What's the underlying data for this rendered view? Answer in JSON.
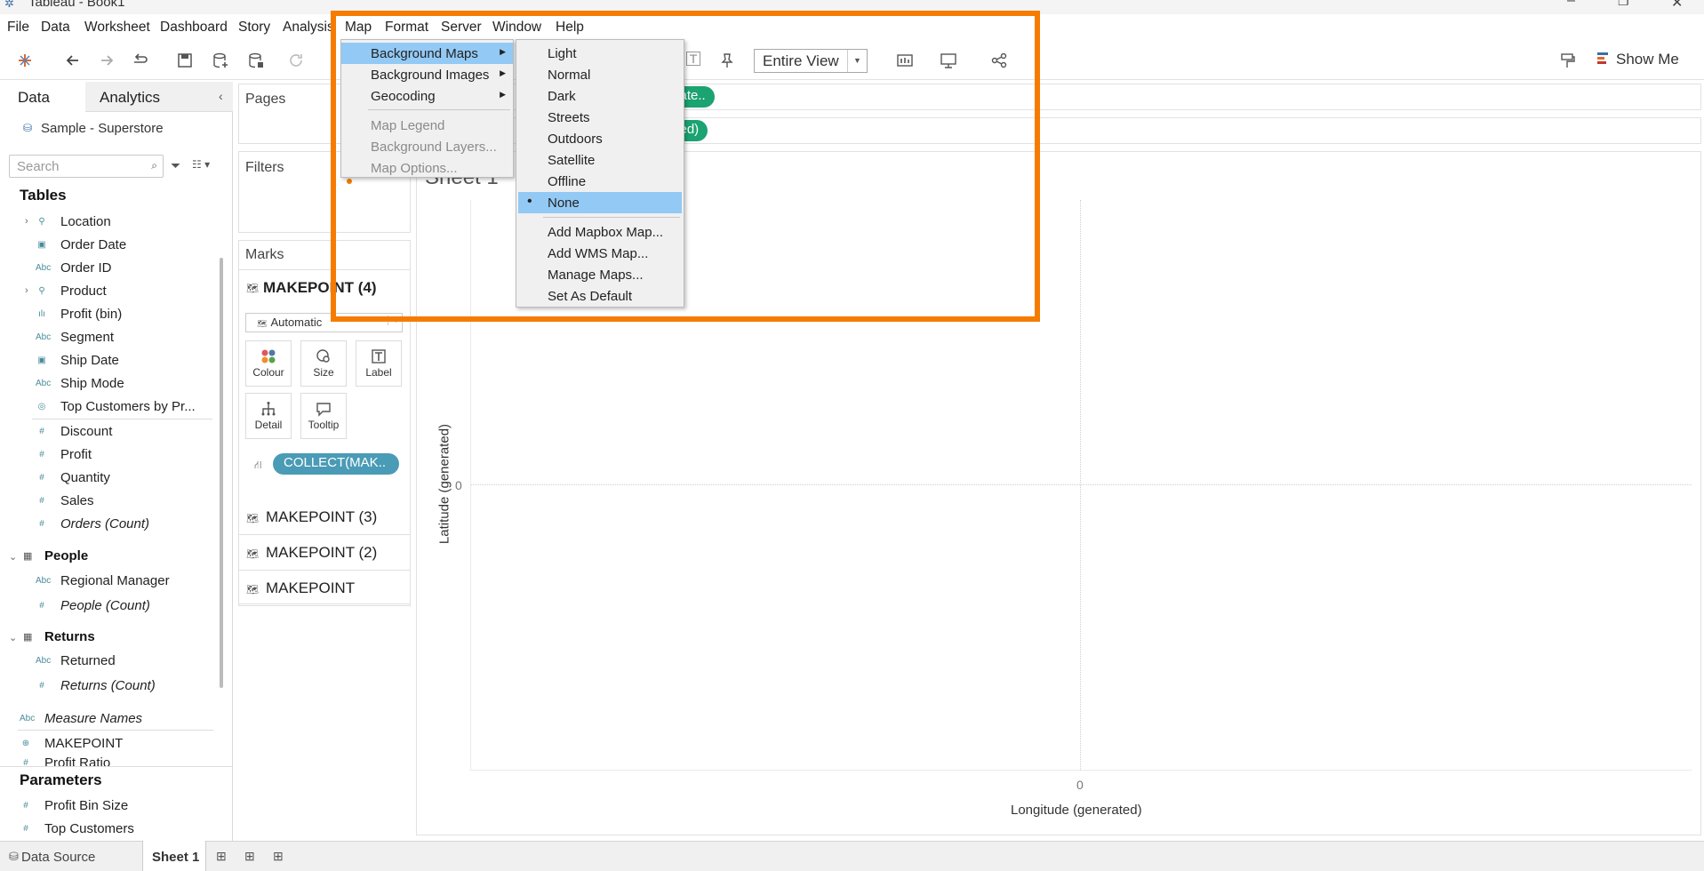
{
  "window": {
    "title": "Tableau - Book1"
  },
  "menubar": {
    "items": [
      "File",
      "Data",
      "Worksheet",
      "Dashboard",
      "Story",
      "Analysis",
      "Map",
      "Format",
      "Server",
      "Window",
      "Help"
    ]
  },
  "toolbar": {
    "view_dropdown": "Entire View",
    "show_me": "Show Me"
  },
  "data_pane": {
    "tabs": [
      "Data",
      "Analytics"
    ],
    "datasource": "Sample - Superstore",
    "search_placeholder": "Search",
    "tables_header": "Tables",
    "fields": [
      {
        "name": "Location",
        "type": "hierarchy"
      },
      {
        "name": "Order Date",
        "type": "date"
      },
      {
        "name": "Order ID",
        "type": "string"
      },
      {
        "name": "Product",
        "type": "hierarchy"
      },
      {
        "name": "Profit (bin)",
        "type": "bin"
      },
      {
        "name": "Segment",
        "type": "string"
      },
      {
        "name": "Ship Date",
        "type": "date"
      },
      {
        "name": "Ship Mode",
        "type": "string"
      },
      {
        "name": "Top Customers by Pr...",
        "type": "set"
      },
      {
        "name": "Discount",
        "type": "number"
      },
      {
        "name": "Profit",
        "type": "number"
      },
      {
        "name": "Quantity",
        "type": "number"
      },
      {
        "name": "Sales",
        "type": "number"
      },
      {
        "name": "Orders (Count)",
        "type": "number"
      }
    ],
    "people_header": "People",
    "people_fields": [
      {
        "name": "Regional Manager",
        "type": "string"
      },
      {
        "name": "People (Count)",
        "type": "number"
      }
    ],
    "returns_header": "Returns",
    "returns_fields": [
      {
        "name": "Returned",
        "type": "string"
      },
      {
        "name": "Returns (Count)",
        "type": "number"
      }
    ],
    "extra_fields": [
      {
        "name": "Measure Names",
        "type": "string"
      },
      {
        "name": "MAKEPOINT",
        "type": "geo"
      },
      {
        "name": "Profit Ratio",
        "type": "number"
      }
    ],
    "parameters_header": "Parameters",
    "parameters": [
      "Profit Bin Size",
      "Top Customers"
    ]
  },
  "shelves": {
    "pages": "Pages",
    "filters": "Filters",
    "marks": "Marks",
    "marks_layer": "MAKEPOINT (4)",
    "mark_type": "Automatic",
    "mark_buttons": [
      "Colour",
      "Size",
      "Label",
      "Detail",
      "Tooltip"
    ],
    "collect_pill": "COLLECT(MAK..",
    "layers": [
      "MAKEPOINT (3)",
      "MAKEPOINT (2)",
      "MAKEPOINT"
    ],
    "columns_pill": "...ate..",
    "rows_pill": "...ed)"
  },
  "viz": {
    "sheet_title": "Sheet 1",
    "y_axis_label": "Latitude (generated)",
    "x_axis_label": "Longitude (generated)",
    "y_tick": "0",
    "x_tick": "0"
  },
  "map_menu": {
    "items": [
      "Background Maps",
      "Background Images",
      "Geocoding",
      "Map Legend",
      "Background Layers...",
      "Map Options..."
    ]
  },
  "background_maps_submenu": {
    "items": [
      "Light",
      "Normal",
      "Dark",
      "Streets",
      "Outdoors",
      "Satellite",
      "Offline",
      "None"
    ],
    "selected": "None",
    "actions": [
      "Add Mapbox Map...",
      "Add WMS Map...",
      "Manage Maps...",
      "Set As Default"
    ]
  },
  "statusbar": {
    "data_source": "Data Source",
    "sheet_tab": "Sheet 1"
  },
  "colors": {
    "highlight_border": "#f57c00",
    "menu_highlight": "#93c9f5",
    "pill_blue": "#4a9bb5",
    "pill_green": "#1ba371"
  }
}
